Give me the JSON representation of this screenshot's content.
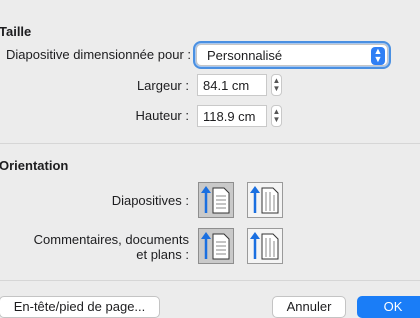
{
  "size_section": {
    "title": "Taille",
    "slides_sized_for_label": "Diapositive dimensionnée pour :",
    "slides_sized_for_value": "Personnalisé",
    "width_label": "Largeur :",
    "width_value": "84.1 cm",
    "height_label": "Hauteur :",
    "height_value": "118.9 cm"
  },
  "orientation_section": {
    "title": "Orientation",
    "slides_label": "Diapositives :",
    "notes_label_line1": "Commentaires, documents",
    "notes_label_line2": "et plans :",
    "slides_selected": "portrait",
    "notes_selected": "portrait"
  },
  "footer": {
    "header_footer_button": "En-tête/pied de page...",
    "cancel_button": "Annuler",
    "ok_button": "OK"
  },
  "colors": {
    "accent": "#1a7df7",
    "background": "#ececec"
  }
}
